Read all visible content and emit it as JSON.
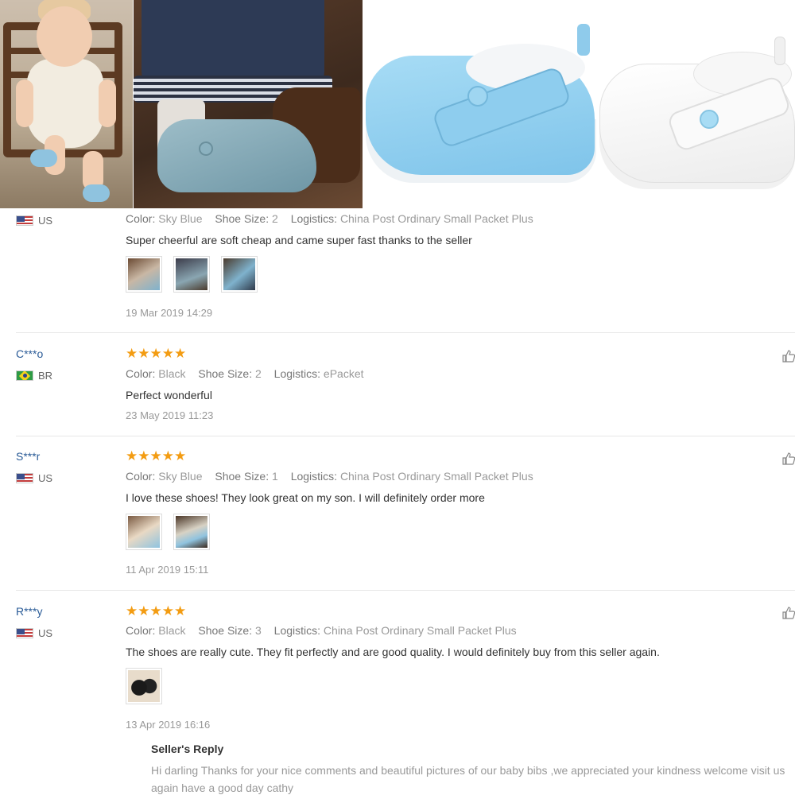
{
  "reviews": [
    {
      "user": "",
      "country": "US",
      "flag": "us",
      "stars": "★★★★★",
      "show_stars": false,
      "color_label": "Color:",
      "color": "Sky Blue",
      "size_label": "Shoe Size:",
      "size": "2",
      "logistics_label": "Logistics:",
      "logistics": "China Post Ordinary Small Packet Plus",
      "text": "Super cheerful are soft cheap and came super fast thanks to the seller",
      "photo_count": 3,
      "date": "19 Mar 2019 14:29"
    },
    {
      "user": "C***o",
      "country": "BR",
      "flag": "br",
      "stars": "★★★★★",
      "color_label": "Color:",
      "color": "Black",
      "size_label": "Shoe Size:",
      "size": "2",
      "logistics_label": "Logistics:",
      "logistics": "ePacket",
      "text": "Perfect wonderful",
      "photo_count": 0,
      "date": "23 May 2019 11:23"
    },
    {
      "user": "S***r",
      "country": "US",
      "flag": "us",
      "stars": "★★★★★",
      "color_label": "Color:",
      "color": "Sky Blue",
      "size_label": "Shoe Size:",
      "size": "1",
      "logistics_label": "Logistics:",
      "logistics": "China Post Ordinary Small Packet Plus",
      "text": "I love these shoes! They look great on my son. I will definitely order more",
      "photo_count": 2,
      "date": "11 Apr 2019 15:11"
    },
    {
      "user": "R***y",
      "country": "US",
      "flag": "us",
      "stars": "★★★★★",
      "color_label": "Color:",
      "color": "Black",
      "size_label": "Shoe Size:",
      "size": "3",
      "logistics_label": "Logistics:",
      "logistics": "China Post Ordinary Small Packet Plus",
      "text": "The shoes are really cute. They fit perfectly and are good quality. I would definitely buy from this seller again.",
      "photo_count": 1,
      "date": "13 Apr 2019 16:16",
      "seller_reply_title": "Seller's Reply",
      "seller_reply": "Hi darling Thanks for your nice comments and beautiful pictures of our baby bibs ,we appreciated your kindness welcome visit us again have a good day cathy"
    }
  ],
  "colors": {
    "star": "#f39c12",
    "username": "#2a5b97",
    "muted": "#999999",
    "separator": "#e6e6e6"
  }
}
